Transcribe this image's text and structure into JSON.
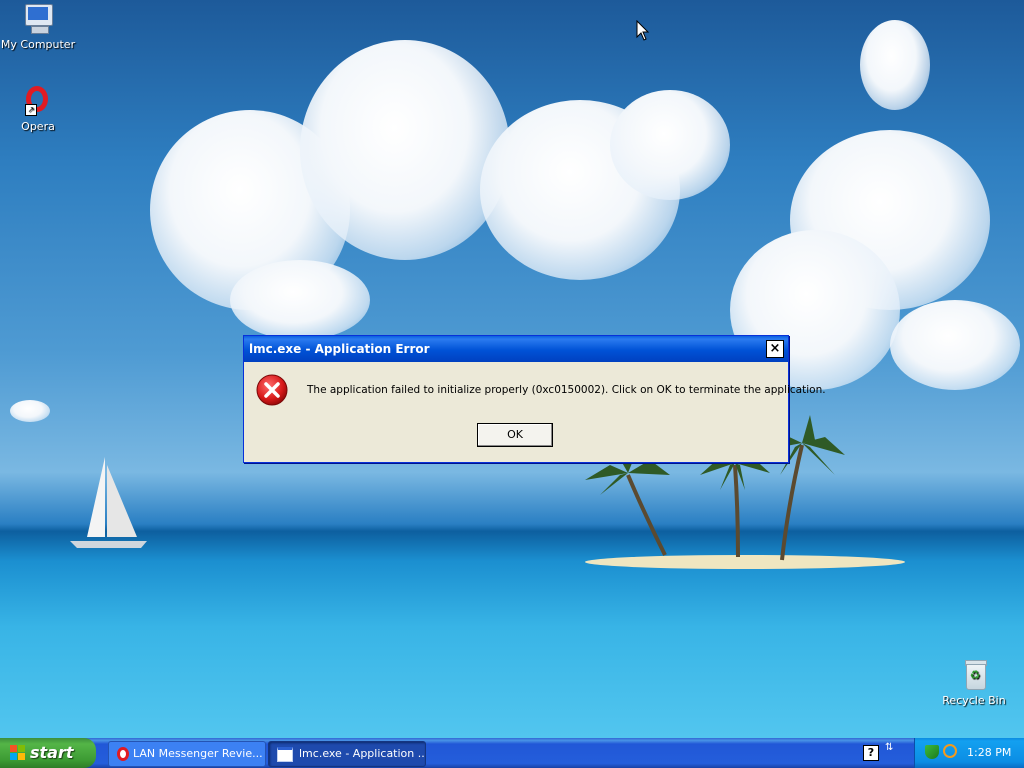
{
  "desktop": {
    "icons": [
      {
        "label": "My Computer",
        "icon": "my-computer-icon"
      },
      {
        "label": "Opera",
        "icon": "opera-icon"
      },
      {
        "label": "Recycle Bin",
        "icon": "recycle-bin-icon"
      }
    ]
  },
  "dialog": {
    "title": "lmc.exe - Application Error",
    "close_label": "×",
    "message": "The application failed to initialize properly (0xc0150002). Click on OK to terminate the application.",
    "ok_label": "OK",
    "icon": "error-icon"
  },
  "taskbar": {
    "start_label": "start",
    "tasks": [
      {
        "label": "LAN Messenger Revie...",
        "icon": "opera-icon",
        "active": false
      },
      {
        "label": "lmc.exe - Application ...",
        "icon": "window-icon",
        "active": true
      }
    ],
    "tray": {
      "clock": "1:28 PM",
      "icons": [
        "help-icon",
        "network-icon",
        "shield-icon",
        "search-icon"
      ]
    }
  },
  "colors": {
    "titlebar": "#0052d6",
    "dialog_bg": "#ece9d8",
    "taskbar": "#245edb",
    "start": "#3c9a33",
    "tray": "#0b8de4"
  }
}
